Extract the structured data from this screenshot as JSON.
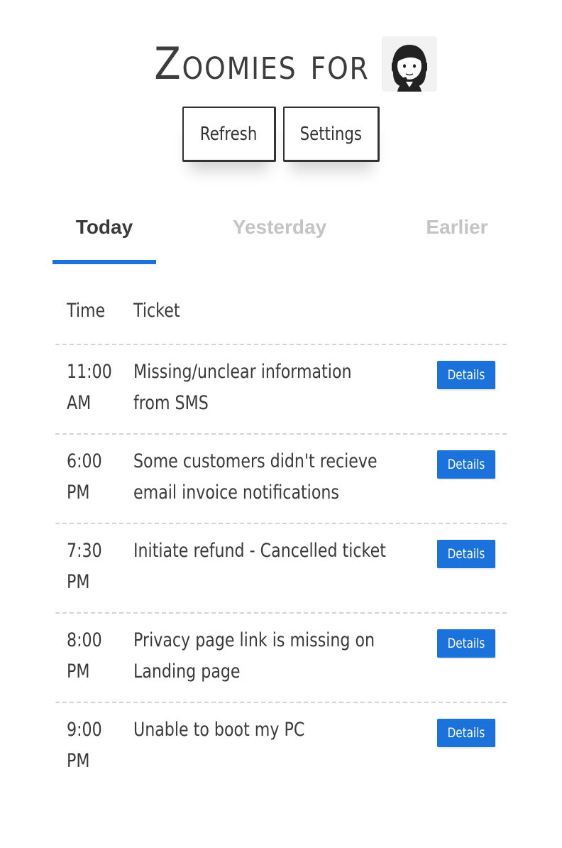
{
  "header": {
    "title": "Zoomies for",
    "avatar_icon": "support-agent-icon"
  },
  "toolbar": {
    "refresh_label": "Refresh",
    "settings_label": "Settings"
  },
  "tabs": [
    {
      "label": "Today",
      "active": true
    },
    {
      "label": "Yesterday",
      "active": false
    },
    {
      "label": "Earlier",
      "active": false
    }
  ],
  "colors": {
    "accent": "#1c72db",
    "inactive_tab": "#c4c4c4",
    "text": "#3a3a3a"
  },
  "table": {
    "headers": {
      "time": "Time",
      "ticket": "Ticket"
    },
    "rows": [
      {
        "time": "11:00 AM",
        "ticket": "Missing/unclear information from SMS",
        "action": "Details"
      },
      {
        "time": "6:00 PM",
        "ticket": "Some customers didn't recieve email invoice notifications",
        "action": "Details"
      },
      {
        "time": "7:30 PM",
        "ticket": "Initiate refund - Cancelled ticket",
        "action": "Details"
      },
      {
        "time": "8:00 PM",
        "ticket": "Privacy page link is missing on Landing page",
        "action": "Details"
      },
      {
        "time": "9:00 PM",
        "ticket": "Unable to boot my PC",
        "action": "Details"
      }
    ]
  }
}
